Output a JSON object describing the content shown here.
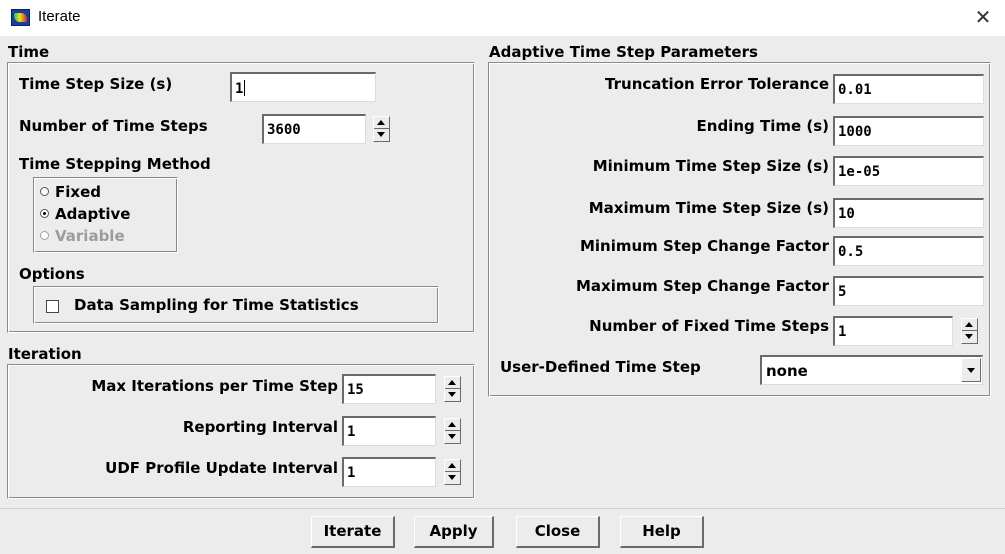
{
  "window": {
    "title": "Iterate",
    "icon": "fluent-app-icon",
    "close_glyph": "✕"
  },
  "time": {
    "section_title": "Time",
    "time_step_size": {
      "label": "Time Step Size (s)",
      "value": "1"
    },
    "number_of_time_steps": {
      "label": "Number of Time Steps",
      "value": "3600"
    },
    "method": {
      "label": "Time Stepping Method",
      "options": [
        "Fixed",
        "Adaptive",
        "Variable"
      ],
      "selected": "Adaptive",
      "disabled": [
        "Variable"
      ]
    },
    "options": {
      "label": "Options",
      "data_sampling": {
        "label": "Data Sampling for Time Statistics",
        "checked": false
      }
    }
  },
  "adaptive": {
    "section_title": "Adaptive Time Step Parameters",
    "truncation_error_tolerance": {
      "label": "Truncation Error Tolerance",
      "value": "0.01"
    },
    "ending_time": {
      "label": "Ending Time (s)",
      "value": "1000"
    },
    "min_time_step_size": {
      "label": "Minimum Time Step Size (s)",
      "value": "1e-05"
    },
    "max_time_step_size": {
      "label": "Maximum Time Step Size (s)",
      "value": "10"
    },
    "min_step_change_factor": {
      "label": "Minimum Step Change Factor",
      "value": "0.5"
    },
    "max_step_change_factor": {
      "label": "Maximum Step Change Factor",
      "value": "5"
    },
    "number_of_fixed_time_steps": {
      "label": "Number of Fixed Time Steps",
      "value": "1"
    },
    "user_defined_time_step": {
      "label": "User-Defined Time Step",
      "value": "none"
    }
  },
  "iteration": {
    "section_title": "Iteration",
    "max_iterations_per_time_step": {
      "label": "Max Iterations per Time Step",
      "value": "15"
    },
    "reporting_interval": {
      "label": "Reporting Interval",
      "value": "1"
    },
    "udf_profile_update_interval": {
      "label": "UDF Profile Update Interval",
      "value": "1"
    }
  },
  "buttons": {
    "iterate": "Iterate",
    "apply": "Apply",
    "close": "Close",
    "help": "Help"
  },
  "colors": {
    "background": "#ececec",
    "titlebar": "#ffffff",
    "field": "#ffffff",
    "disabled_text": "#9c9c9c"
  }
}
